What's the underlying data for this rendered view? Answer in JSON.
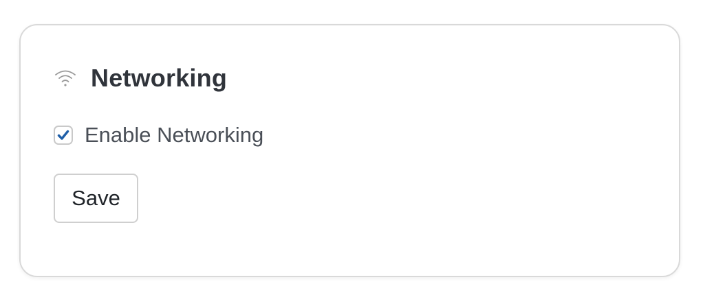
{
  "panel": {
    "icon": "wifi-icon",
    "title": "Networking"
  },
  "option": {
    "label": "Enable Networking",
    "checked": true
  },
  "actions": {
    "save_label": "Save"
  },
  "colors": {
    "checkmark": "#1f5fa8",
    "title": "#30343b",
    "icon": "#9a9a9a"
  }
}
